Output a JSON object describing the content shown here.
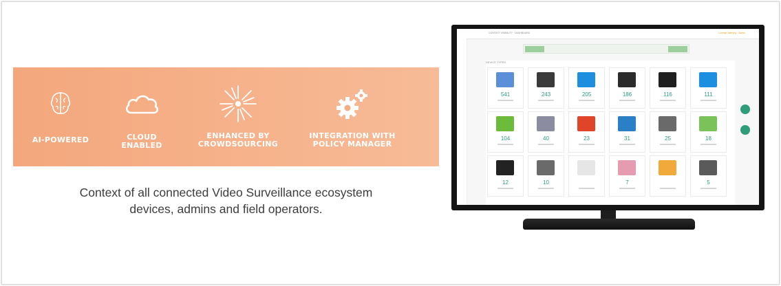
{
  "features": [
    {
      "label": "AI-POWERED",
      "icon": "brain-icon"
    },
    {
      "label": "CLOUD\nENABLED",
      "icon": "cloud-icon"
    },
    {
      "label": "ENHANCED BY\nCROWDSOURCING",
      "icon": "crowdsourcing-burst-icon"
    },
    {
      "label": "INTEGRATION WITH\nPOLICY MANAGER",
      "icon": "gears-icon"
    }
  ],
  "caption": {
    "line1": "Context of all connected Video Surveillance ecosystem",
    "line2": "devices, admins and field operators."
  },
  "screen": {
    "section_title": "DEVICE TYPES",
    "tiles": [
      {
        "count": "541",
        "icon": "mac-icon",
        "color": "#5b8fd8"
      },
      {
        "count": "243",
        "icon": "phone-icon",
        "color": "#3a3a3a"
      },
      {
        "count": "205",
        "icon": "windows-icon",
        "color": "#1e8fe0"
      },
      {
        "count": "186",
        "icon": "laptop-icon",
        "color": "#2b2b2b"
      },
      {
        "count": "116",
        "icon": "monitor-icon",
        "color": "#1f1f1f"
      },
      {
        "count": "111",
        "icon": "windows-icon",
        "color": "#1e8fe0"
      },
      {
        "count": "104",
        "icon": "android-icon",
        "color": "#6dbb3a"
      },
      {
        "count": "40",
        "icon": "apple-icon",
        "color": "#8c8ca0"
      },
      {
        "count": "23",
        "icon": "windows-xp-icon",
        "color": "#e0452a"
      },
      {
        "count": "31",
        "icon": "hp-icon",
        "color": "#2a7fc7"
      },
      {
        "count": "25",
        "icon": "server-icon",
        "color": "#6a6a6a"
      },
      {
        "count": "18",
        "icon": "android-icon",
        "color": "#7cc25a"
      },
      {
        "count": "12",
        "icon": "tablet-icon",
        "color": "#222222"
      },
      {
        "count": "10",
        "icon": "server-icon",
        "color": "#6a6a6a"
      },
      {
        "count": "",
        "icon": "unknown-icon",
        "color": "#e6e6e6"
      },
      {
        "count": "7",
        "icon": "debian-icon",
        "color": "#e59bb0"
      },
      {
        "count": "",
        "icon": "ubuntu-icon",
        "color": "#f2a93b"
      },
      {
        "count": "5",
        "icon": "server-icon",
        "color": "#5a5a5a"
      }
    ]
  },
  "colors": {
    "band": "#f5ad84",
    "accent_green": "#2f9d7a",
    "caption": "#3d3d3d"
  }
}
